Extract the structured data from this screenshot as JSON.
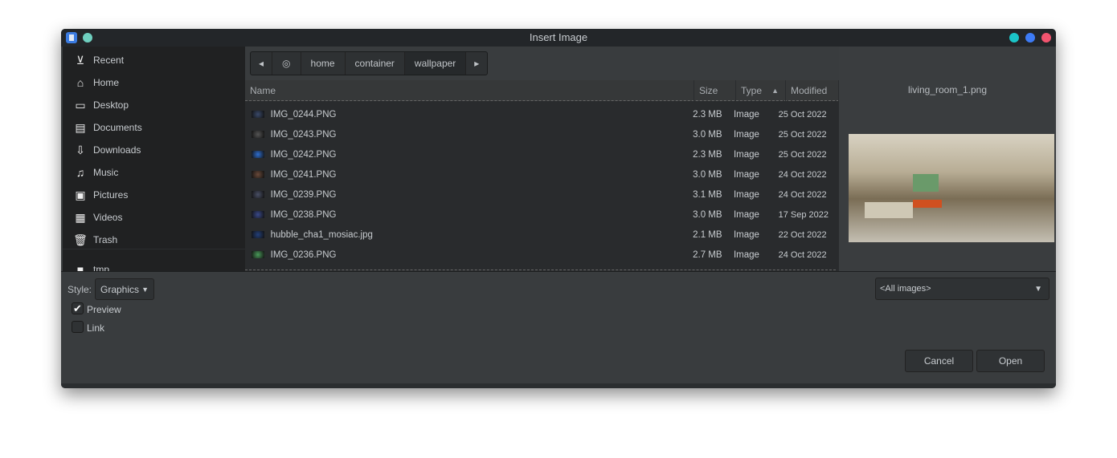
{
  "window": {
    "title": "Insert Image",
    "controls": {
      "minimize_color": "#1bc5c8",
      "maximize_color": "#3d7bf5",
      "close_color": "#f2546f"
    },
    "pin_color": "#6fd0c0"
  },
  "sidebar": {
    "items": [
      {
        "label": "Recent",
        "icon": "recent-icon"
      },
      {
        "label": "Home",
        "icon": "home-icon"
      },
      {
        "label": "Desktop",
        "icon": "desktop-icon"
      },
      {
        "label": "Documents",
        "icon": "document-icon"
      },
      {
        "label": "Downloads",
        "icon": "download-icon"
      },
      {
        "label": "Music",
        "icon": "music-icon"
      },
      {
        "label": "Pictures",
        "icon": "pictures-icon"
      },
      {
        "label": "Videos",
        "icon": "videos-icon"
      },
      {
        "label": "Trash",
        "icon": "trash-icon"
      },
      {
        "label": "tmp",
        "icon": "folder-icon"
      }
    ]
  },
  "breadcrumb": {
    "items": [
      "home",
      "container",
      "wallpaper"
    ],
    "active": "wallpaper"
  },
  "files": {
    "columns": {
      "name": "Name",
      "size": "Size",
      "type": "Type",
      "modified": "Modified"
    },
    "sort": "type-ascending",
    "rows": [
      {
        "name": "IMG_0244.PNG",
        "size": "2.3 MB",
        "type": "Image",
        "modified": "25 Oct 2022",
        "thumb": "#3a4a6a"
      },
      {
        "name": "IMG_0243.PNG",
        "size": "3.0 MB",
        "type": "Image",
        "modified": "25 Oct 2022",
        "thumb": "#555"
      },
      {
        "name": "IMG_0242.PNG",
        "size": "2.3 MB",
        "type": "Image",
        "modified": "25 Oct 2022",
        "thumb": "#2f6fd0"
      },
      {
        "name": "IMG_0241.PNG",
        "size": "3.0 MB",
        "type": "Image",
        "modified": "24 Oct 2022",
        "thumb": "#6a4a3a"
      },
      {
        "name": "IMG_0239.PNG",
        "size": "3.1 MB",
        "type": "Image",
        "modified": "24 Oct 2022",
        "thumb": "#4a5066"
      },
      {
        "name": "IMG_0238.PNG",
        "size": "3.0 MB",
        "type": "Image",
        "modified": "17 Sep 2022",
        "thumb": "#3a4a8a"
      },
      {
        "name": "hubble_cha1_mosiac.jpg",
        "size": "2.1 MB",
        "type": "Image",
        "modified": "22 Oct 2022",
        "thumb": "#23407a"
      },
      {
        "name": "IMG_0236.PNG",
        "size": "2.7 MB",
        "type": "Image",
        "modified": "24 Oct 2022",
        "thumb": "#4a9a5a"
      }
    ]
  },
  "preview": {
    "filename": "living_room_1.png"
  },
  "options": {
    "style_label": "Style:",
    "style_value": "Graphics",
    "preview_label": "Preview",
    "preview_checked": true,
    "link_label": "Link",
    "link_checked": false,
    "filter_value": "<All images>"
  },
  "buttons": {
    "cancel": "Cancel",
    "open": "Open"
  }
}
